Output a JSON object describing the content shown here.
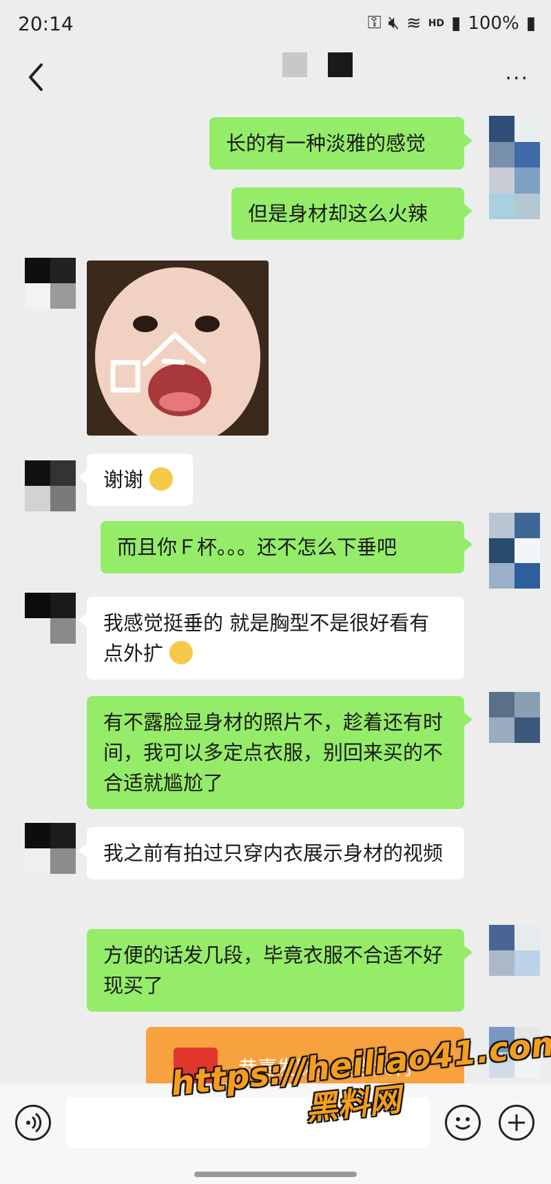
{
  "status_bar": {
    "time": "20:14",
    "hd_label": "HD",
    "battery": "100%"
  },
  "nav": {
    "title": "■ ■",
    "more_label": "..."
  },
  "messages": [
    {
      "from": "me",
      "text": "长的有一种淡雅的感觉"
    },
    {
      "from": "me",
      "text": "但是身材却这么火辣"
    },
    {
      "from": "other",
      "type": "sticker",
      "text_on_sticker": "口"
    },
    {
      "from": "other",
      "text": "谢谢"
    },
    {
      "from": "me",
      "text": "而且你Ｆ杯。。。还不怎么下垂吧"
    },
    {
      "from": "other",
      "text": "我感觉挺垂的 就是胸型不是很好看有点外扩"
    },
    {
      "from": "me",
      "text": "有不露脸显身材的照片不，趁着还有时间，我可以多定点衣服，别回来买的不合适就尴尬了"
    },
    {
      "from": "other",
      "text": "我之前有拍过只穿内衣展示身材的视频"
    },
    {
      "from": "me",
      "text": "方便的话发几段，毕竟衣服不合适不好现买了"
    },
    {
      "from": "me",
      "type": "red_packet",
      "text": "恭喜发财，大吉大利"
    }
  ],
  "input": {
    "placeholder": ""
  },
  "watermark": {
    "line1": "https://heiliao41.com",
    "line2": "黑料网"
  },
  "colors": {
    "bg": "#ededed",
    "bubble_me": "#95ec69",
    "bubble_other": "#ffffff",
    "red_packet": "#f8a13f"
  }
}
